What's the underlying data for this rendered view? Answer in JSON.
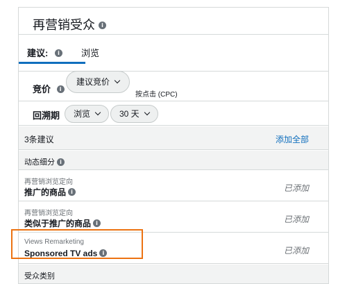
{
  "header": {
    "title": "再营销受众"
  },
  "tabs": [
    {
      "label": "建议:"
    },
    {
      "label": "浏览"
    }
  ],
  "bid": {
    "label": "竞价",
    "dropdown": "建议竞价",
    "note": "按点击 (CPC)"
  },
  "lookback": {
    "label": "回溯期",
    "type_dropdown": "浏览",
    "days_dropdown": "30 天"
  },
  "suggestions": {
    "count_text": "3条建议",
    "add_all": "添加全部"
  },
  "sections": {
    "dynamic": "动态细分",
    "category": "受众类别"
  },
  "items": [
    {
      "sub": "再营销浏览定向",
      "main": "推广的商品",
      "status": "已添加"
    },
    {
      "sub": "再营销浏览定向",
      "main": "类似于推广的商品",
      "status": "已添加"
    },
    {
      "sub": "Views Remarketing",
      "main": "Sponsored TV ads",
      "status": "已添加"
    }
  ],
  "colors": {
    "accent": "#0f6ebd",
    "highlight": "#ec7211"
  },
  "icons": {
    "info": "info-icon",
    "chevron": "chevron-down-icon"
  }
}
